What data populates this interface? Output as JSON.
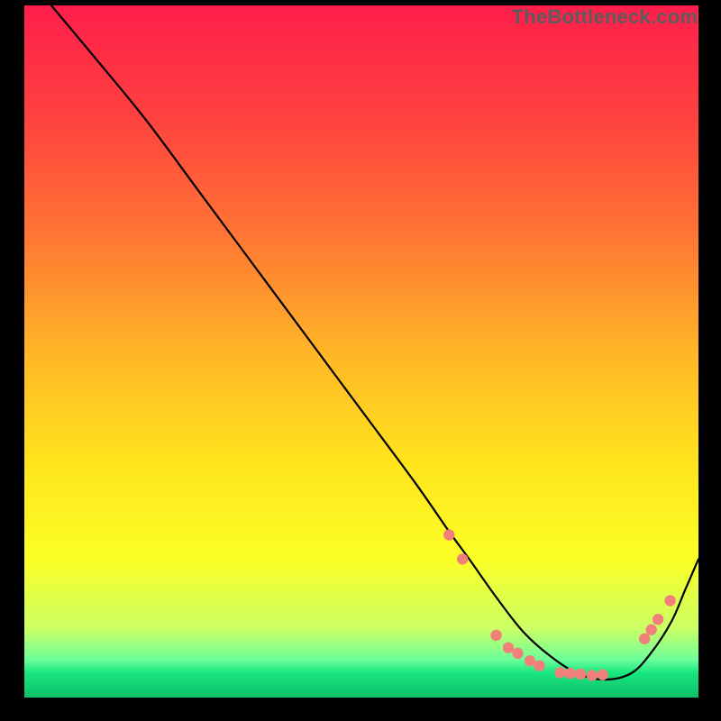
{
  "watermark": "TheBottleneck.com",
  "chart_data": {
    "type": "line",
    "title": "",
    "xlabel": "",
    "ylabel": "",
    "xlim": [
      0,
      100
    ],
    "ylim": [
      0,
      100
    ],
    "background_gradient": {
      "stops": [
        {
          "offset": 0.0,
          "color": "#ff1e4b"
        },
        {
          "offset": 0.16,
          "color": "#ff4140"
        },
        {
          "offset": 0.33,
          "color": "#ff7534"
        },
        {
          "offset": 0.5,
          "color": "#ffb527"
        },
        {
          "offset": 0.66,
          "color": "#ffe41c"
        },
        {
          "offset": 0.8,
          "color": "#fbff26"
        },
        {
          "offset": 0.9,
          "color": "#ccff65"
        },
        {
          "offset": 0.945,
          "color": "#6dff9a"
        },
        {
          "offset": 0.965,
          "color": "#17e57e"
        },
        {
          "offset": 1.0,
          "color": "#0fbf6a"
        }
      ]
    },
    "series": [
      {
        "name": "curve",
        "stroke": "#000000",
        "stroke_width": 2.2,
        "x": [
          4,
          10,
          18,
          26,
          34,
          42,
          50,
          58,
          63,
          66,
          70,
          74,
          78,
          82,
          86,
          90,
          93,
          96,
          98,
          100
        ],
        "y": [
          100,
          93,
          83.5,
          73,
          62.5,
          52,
          41.5,
          31,
          24,
          20,
          14.5,
          9.5,
          6,
          3.5,
          2.6,
          3.5,
          6.5,
          11,
          15.5,
          20
        ]
      }
    ],
    "markers": {
      "name": "dots",
      "fill": "#f08079",
      "r": 6.2,
      "points": [
        {
          "x": 63.0,
          "y": 23.5
        },
        {
          "x": 65.0,
          "y": 20.0
        },
        {
          "x": 70.0,
          "y": 9.0
        },
        {
          "x": 71.8,
          "y": 7.2
        },
        {
          "x": 73.2,
          "y": 6.4
        },
        {
          "x": 75.0,
          "y": 5.3
        },
        {
          "x": 76.4,
          "y": 4.6
        },
        {
          "x": 79.5,
          "y": 3.6
        },
        {
          "x": 81.0,
          "y": 3.5
        },
        {
          "x": 82.5,
          "y": 3.4
        },
        {
          "x": 84.2,
          "y": 3.2
        },
        {
          "x": 85.8,
          "y": 3.3
        },
        {
          "x": 92.0,
          "y": 8.5
        },
        {
          "x": 93.0,
          "y": 9.8
        },
        {
          "x": 94.0,
          "y": 11.3
        },
        {
          "x": 95.8,
          "y": 14.0
        }
      ]
    }
  }
}
